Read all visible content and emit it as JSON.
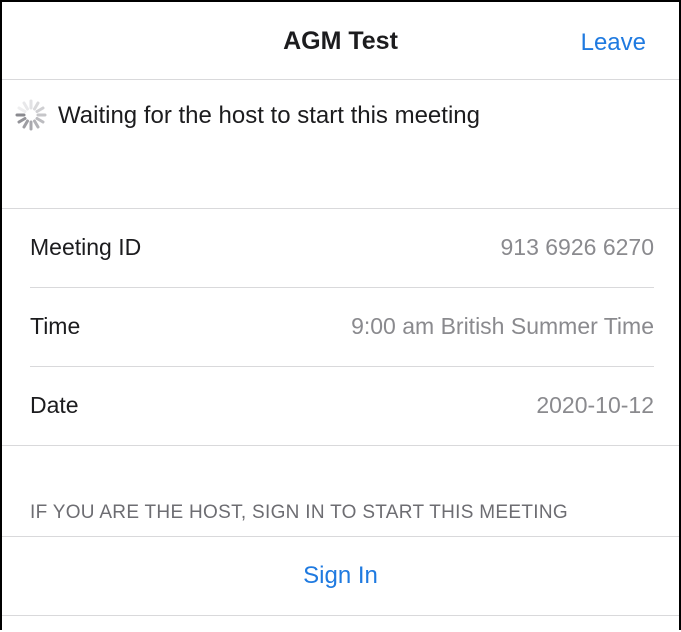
{
  "header": {
    "title": "AGM Test",
    "leave_label": "Leave"
  },
  "status": {
    "icon": "spinner-icon",
    "text": "Waiting for the host to start this meeting"
  },
  "details": {
    "meeting_id": {
      "label": "Meeting ID",
      "value": "913 6926 6270"
    },
    "time": {
      "label": "Time",
      "value": "9:00 am British Summer Time"
    },
    "date": {
      "label": "Date",
      "value": "2020-10-12"
    }
  },
  "host": {
    "note": "IF YOU ARE THE HOST, SIGN IN TO START THIS MEETING",
    "sign_in_label": "Sign In"
  },
  "colors": {
    "accent": "#1f7ae0",
    "text": "#1c1c1e",
    "secondary_text": "#8a8a8e",
    "divider": "#d9d9db"
  }
}
